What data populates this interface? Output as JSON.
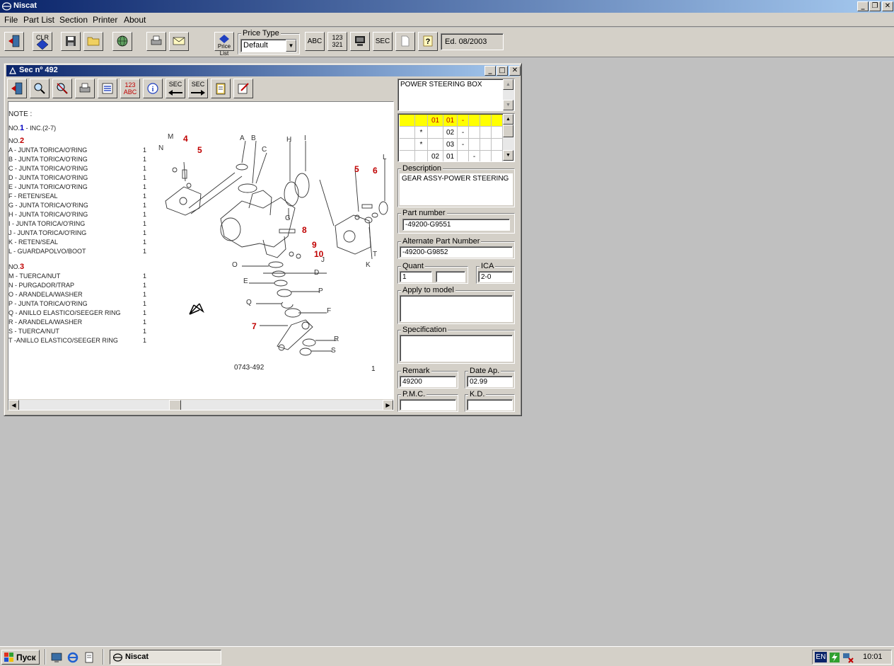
{
  "app": {
    "title": "Niscat"
  },
  "menu": {
    "items": [
      "File",
      "Part List",
      "Section",
      "Printer",
      "About"
    ]
  },
  "toolbar": {
    "clr_label": "CLR",
    "price_list_label": "Price List",
    "price_type_label": "Price Type",
    "price_type_value": "Default",
    "abc_label": "ABC",
    "num_label": "123\n321",
    "sec_label": "SEC",
    "edition": "Ed. 08/2003"
  },
  "section_window": {
    "title": "Sec nº 492",
    "toolbar_labels": {
      "num_abc": "123 ABC",
      "sec_prev": "SEC",
      "sec_next": "SEC"
    }
  },
  "drawing": {
    "note": "NOTE :",
    "no1": "NO.",
    "no1_num": "1",
    "no1_text": "- INC.(2-7)",
    "no2": "NO.",
    "no2_num": "2",
    "no2_items": [
      "A  - JUNTA TORICA/O'RING",
      "B  - JUNTA TORICA/O'RING",
      "C  - JUNTA TORICA/O'RING",
      "D  - JUNTA TORICA/O'RING",
      "E  - JUNTA TORICA/O'RING",
      "F  - RETEN/SEAL",
      "G  - JUNTA TORICA/O'RING",
      "H  - JUNTA TORICA/O'RING",
      "I   - JUNTA TORICA/O'RING",
      "J   - JUNTA TORICA/O'RING",
      "K  - RETEN/SEAL",
      "L  - GUARDAPOLVO/BOOT"
    ],
    "no3": "NO.",
    "no3_num": "3",
    "no3_items": [
      "M - TUERCA/NUT",
      "N  - PURGADOR/TRAP",
      "O  - ARANDELA/WASHER",
      "P  - JUNTA TORICA/O'RING",
      "Q  - ANILLO ELASTICO/SEEGER RING",
      "R  - ARANDELA/WASHER",
      "S  - TUERCA/NUT",
      "T  -ANILLO ELASTICO/SEEGER RING"
    ],
    "qty": "1",
    "ref": "0743-492",
    "page": "1",
    "callouts": [
      "4",
      "5",
      "5",
      "6",
      "8",
      "9",
      "10",
      "7"
    ],
    "letters": [
      "M",
      "N",
      "A",
      "B",
      "C",
      "H",
      "I",
      "L",
      "G",
      "O",
      "D",
      "E",
      "P",
      "Q",
      "F",
      "R",
      "S",
      "J",
      "K",
      "T"
    ]
  },
  "panel": {
    "section_name": "POWER STEERING BOX",
    "grid_rows": [
      [
        "",
        "",
        "01",
        "01",
        "-"
      ],
      [
        "",
        "*",
        "",
        "02",
        "-"
      ],
      [
        "",
        "*",
        "",
        "03",
        "-"
      ],
      [
        "",
        "",
        "02",
        "01",
        "",
        "-"
      ]
    ],
    "description_label": "Description",
    "description": "GEAR ASSY-POWER STEERING",
    "part_number_label": "Part number",
    "part_number": "-49200-G9551",
    "alt_part_label": "Alternate Part Number",
    "alt_part": "-49200-G9852",
    "quant_label": "Quant",
    "quant": "1",
    "quant2": "",
    "ica_label": "ICA",
    "ica": "2-0",
    "apply_label": "Apply to model",
    "apply": "",
    "spec_label": "Specification",
    "spec": "",
    "remark_label": "Remark",
    "remark": "49200",
    "date_label": "Date Ap.",
    "date": "02.99",
    "pmc_label": "P.M.C.",
    "pmc": "",
    "kd_label": "K.D.",
    "kd": ""
  },
  "taskbar": {
    "start": "Пуск",
    "task": "Niscat",
    "lang": "EN",
    "clock": "10:01"
  },
  "colors": {
    "title_start": "#0a246a",
    "title_end": "#a6caf0",
    "face": "#d4d0c8",
    "selected_row": "#ffff00",
    "callout": "#c00000"
  }
}
